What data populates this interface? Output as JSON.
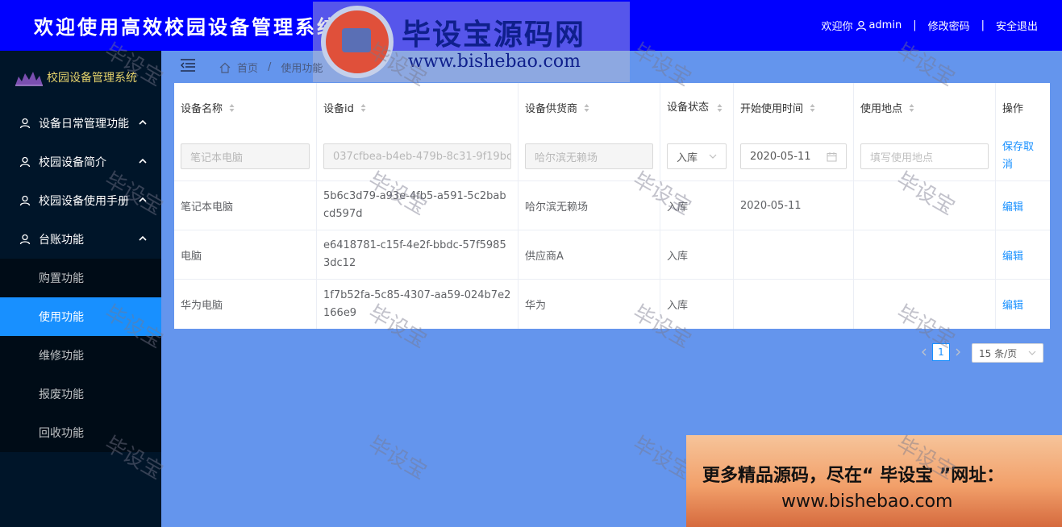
{
  "header": {
    "title": "欢迎使用高效校园设备管理系统",
    "welcome": "欢迎你",
    "username": "admin",
    "change_password": "修改密码",
    "logout": "安全退出",
    "separator": "|"
  },
  "watermark_logo": {
    "brand": "毕设宝源码网",
    "url": "www.bishebao.com"
  },
  "watermark_text": "毕设宝",
  "sidebar": {
    "logo_text": "校园设备管理系统",
    "menus": [
      {
        "label": "设备日常管理功能",
        "icon": "user-icon"
      },
      {
        "label": "校园设备简介",
        "icon": "user-icon"
      },
      {
        "label": "校园设备使用手册",
        "icon": "user-icon"
      },
      {
        "label": "台账功能",
        "icon": "user-icon"
      }
    ],
    "sub_items": [
      "购置功能",
      "使用功能",
      "维修功能",
      "报废功能",
      "回收功能"
    ],
    "active_sub": "使用功能"
  },
  "breadcrumb": {
    "home": "首页",
    "separator": "/",
    "current": "使用功能"
  },
  "table": {
    "columns": [
      "设备名称",
      "设备id",
      "设备供货商",
      "设备状态",
      "开始使用时间",
      "使用地点",
      "操作"
    ],
    "edit_row": {
      "name": "笔记本电脑",
      "id": "037cfbea-b4eb-479b-8c31-9f19bc",
      "supplier": "哈尔滨无赖场",
      "status": "入库",
      "start_date": "2020-05-11",
      "location_placeholder": "填写使用地点",
      "action_save": "保存",
      "action_cancel": "取消"
    },
    "rows": [
      {
        "name": "笔记本电脑",
        "id": "5b6c3d79-a93e-4fb5-a591-5c2babcd597d",
        "supplier": "哈尔滨无赖场",
        "status": "入库",
        "start_date": "2020-05-11",
        "location": "",
        "action": "编辑"
      },
      {
        "name": "电脑",
        "id": "e6418781-c15f-4e2f-bbdc-57f59853dc12",
        "supplier": "供应商A",
        "status": "入库",
        "start_date": "",
        "location": "",
        "action": "编辑"
      },
      {
        "name": "华为电脑",
        "id": "1f7b52fa-5c85-4307-aa59-024b7e2166e9",
        "supplier": "华为",
        "status": "入库",
        "start_date": "",
        "location": "",
        "action": "编辑"
      }
    ]
  },
  "pagination": {
    "current_page": "1",
    "page_size": "15 条/页"
  },
  "promo": {
    "line1": "更多精品源码，尽在“ 毕设宝 ”网址：",
    "line2": "www.bishebao.com"
  },
  "colors": {
    "header_bg": "#0000ff",
    "sidebar_bg": "#001529",
    "active": "#1890ff",
    "content_bg": "#6495ed"
  }
}
